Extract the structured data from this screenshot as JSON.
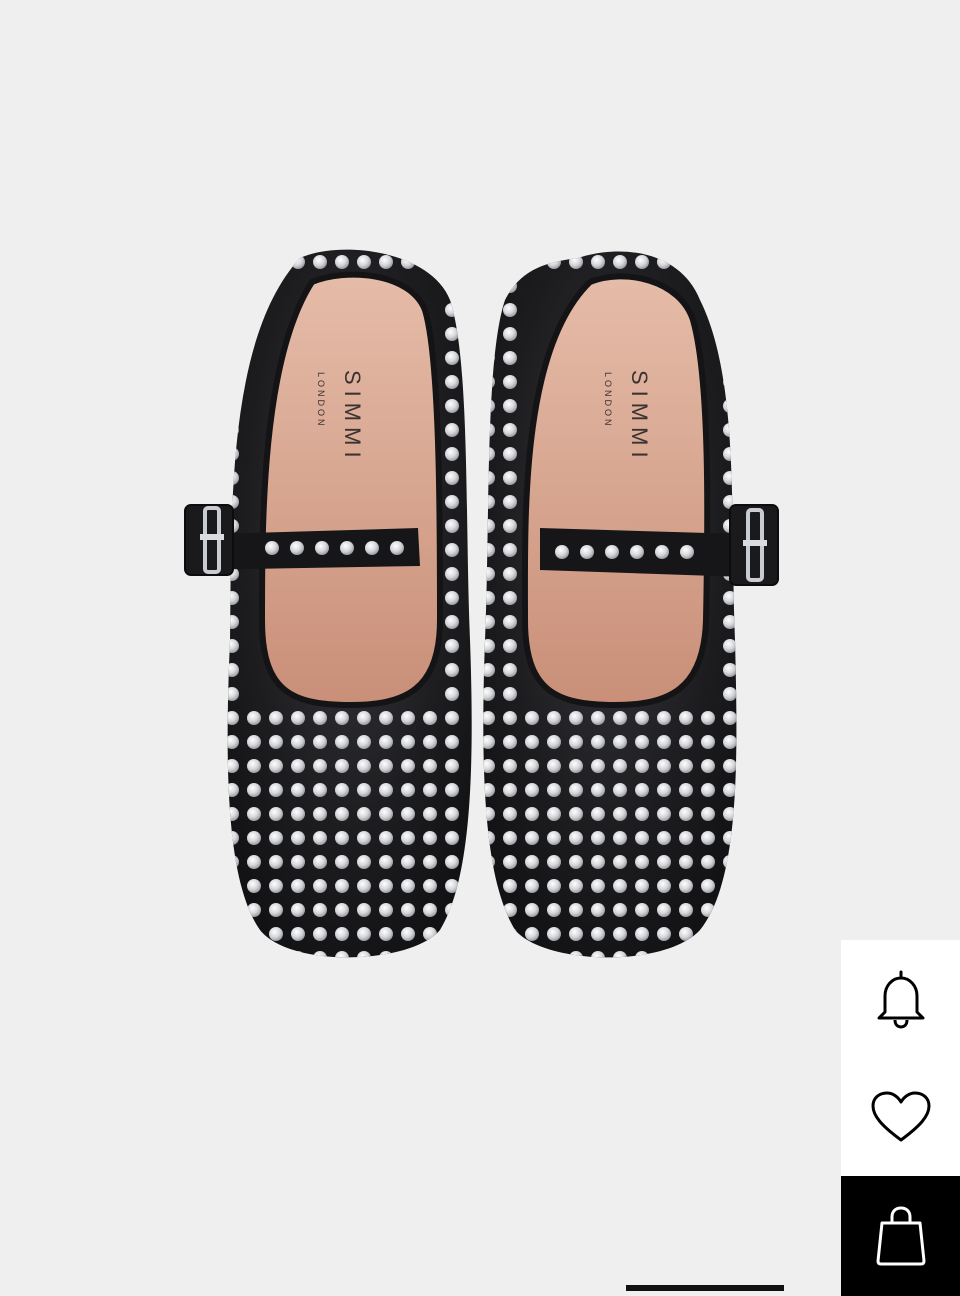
{
  "product": {
    "brand": "SIMMI",
    "brand_sub": "LONDON",
    "image_name": "black-satin-diamante-mary-jane-flats"
  },
  "actions": {
    "notify": "bell-icon",
    "wishlist": "heart-icon",
    "bag": "shopping-bag-icon"
  },
  "colors": {
    "background": "#efefef",
    "shoe_satin": "#1b1b1d",
    "lining": "#d8a995",
    "accent_black": "#000000"
  }
}
